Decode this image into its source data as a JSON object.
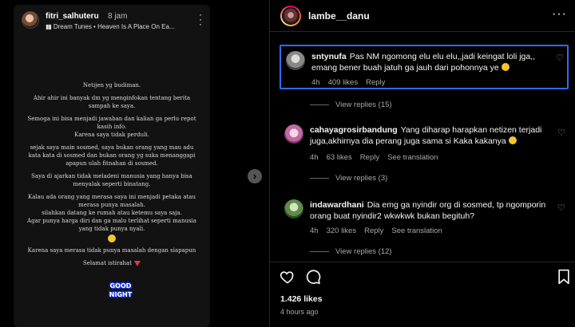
{
  "story": {
    "username": "fitri_salhuteru",
    "time": "8 jam",
    "music": "Dream Tunes • Heaven Is A Place On Ea...",
    "lines": [
      "Netijen yg budiman.",
      "Ahir ahir ini banyak dm yg menginfokan tentang berita sampah ke saya.",
      "Semoga ini bisa menjadi jawaban dan kalian ga perlu repot kasih info.",
      "Karena saya tidak perduli.",
      "sejak saya main sosmed, saya bukan orang yang mau adu kata kata di sosmed dan bukan orang yg suka menanggapi apapun ulah fitnahan di sosmed.",
      "Saya di ajarkan tidak meladeni manusia yang hanya bisa menyalak seperti binatang.",
      "Kalau ada orang yang merasa saya ini menjadi petaka atau merasa punya masalah.",
      "silahkan datang ke rumah atau ketemu saya saja.",
      "Agar punya harga diri dan ga malu terlihat seperti manusia yang tidak punya nyali.",
      "Karena saya merasa tidak  punya masalah dengan siapapun",
      "Selamat istirahat"
    ],
    "sticker_line1": "GOOD",
    "sticker_line2": "NIGHT"
  },
  "post": {
    "username": "lambe__danu",
    "likes": "1.426 likes",
    "time_ago": "4 hours ago"
  },
  "comments": [
    {
      "user": "sntynufa",
      "text": "Pas NM ngomong elu elu elu,,jadi keingat loli jga,, emang bener buah jatuh ga jauh dari pohonnya ye",
      "time": "4h",
      "likes": "409 likes",
      "reply": "Reply",
      "view_replies": "View replies (15)"
    },
    {
      "user": "cahayagrosirbandung",
      "text": "Yang diharap harapkan netizen terjadi juga,akhirnya dia perang juga sama si Kaka kakanya",
      "time": "4h",
      "likes": "63 likes",
      "reply": "Reply",
      "see_translation": "See translation",
      "view_replies": "View replies (3)"
    },
    {
      "user": "indawardhani",
      "text": "Dia emg ga nyindir org di sosmed, tp ngomporin orang buat nyindir2 wkwkwk bukan begituh?",
      "time": "4h",
      "likes": "320 likes",
      "reply": "Reply",
      "see_translation": "See translation",
      "view_replies": "View replies (12)"
    }
  ],
  "icons": {
    "like": "heart-icon",
    "comment": "comment-icon",
    "save": "bookmark-icon",
    "next": "chevron-right-icon"
  },
  "colors": {
    "highlight": "#2f6bff",
    "muted": "#a8a8a8"
  }
}
